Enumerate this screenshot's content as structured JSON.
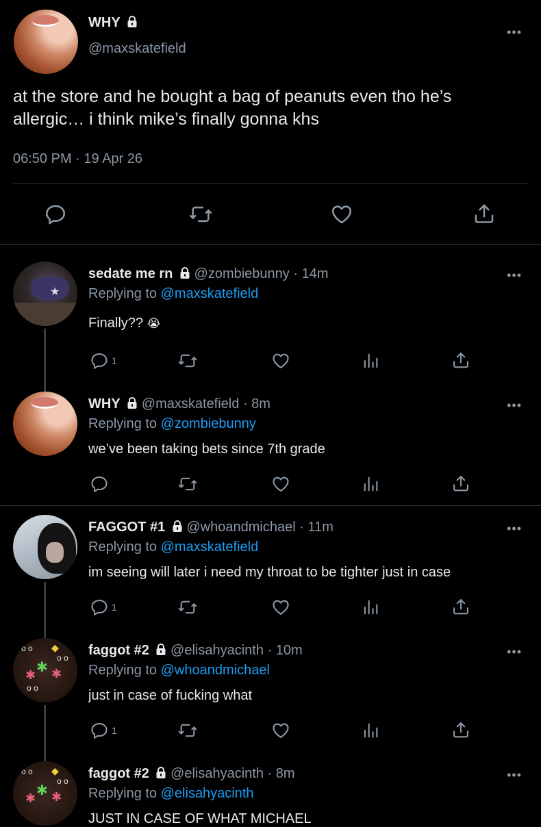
{
  "main_tweet": {
    "display_name": "WHY",
    "handle": "@maxskatefield",
    "text_line1": "at the store and he bought a bag of peanuts even tho he’s",
    "text_line2": "allergic… i think mike’s finally gonna khs",
    "timestamp": "06:50 PM · 19 Apr 26"
  },
  "replies": [
    {
      "display_name": "sedate me rn",
      "handle": "@zombiebunny",
      "time": "· 14m",
      "replying_label": "Replying to",
      "replying_to": "@maxskatefield",
      "text": "Finally??",
      "emoji": "😭",
      "reply_count": "1"
    },
    {
      "display_name": "WHY",
      "handle": "@maxskatefield",
      "time": "· 8m",
      "replying_label": "Replying to",
      "replying_to": "@zombiebunny",
      "text": "we’ve been taking bets since 7th grade",
      "reply_count": ""
    },
    {
      "display_name": "FAGGOT #1",
      "handle": "@whoandmichael",
      "time": "· 11m",
      "replying_label": "Replying to",
      "replying_to": "@maxskatefield",
      "text": "im seeing will later i need my throat to be tighter just in case",
      "reply_count": "1"
    },
    {
      "display_name": "faggot #2",
      "handle": "@elisahyacinth",
      "time": "· 10m",
      "replying_label": "Replying to",
      "replying_to": "@whoandmichael",
      "text": "just in case of fucking what",
      "reply_count": "1"
    },
    {
      "display_name": "faggot #2",
      "handle": "@elisahyacinth",
      "time": "· 8m",
      "replying_label": "Replying to",
      "replying_to": "@elisahyacinth",
      "text": "JUST IN CASE OF WHAT MICHAEL"
    }
  ],
  "more_glyph": "•••",
  "colors": {
    "background": "#000000",
    "text": "#e7e9ea",
    "muted": "#8b98a5",
    "link": "#1d9bf0",
    "divider": "#2f3336"
  },
  "icons": [
    "lock-icon",
    "more-icon",
    "reply-icon",
    "retweet-icon",
    "like-icon",
    "share-icon",
    "analytics-icon"
  ]
}
